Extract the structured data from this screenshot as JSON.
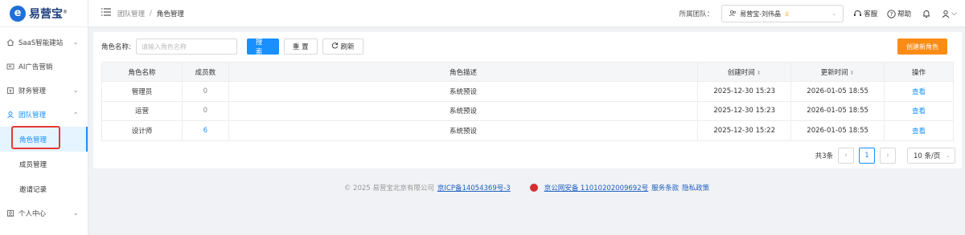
{
  "logo": {
    "text": "易营宝",
    "registered": "®"
  },
  "sidebar": {
    "items": [
      {
        "label": "SaaS智能建站",
        "chevron": "⌄"
      },
      {
        "label": "AI广告营销",
        "chevron": ""
      },
      {
        "label": "财务管理",
        "chevron": "⌄"
      },
      {
        "label": "团队管理",
        "chevron": "⌃"
      }
    ],
    "sub_items": [
      {
        "label": "角色管理"
      },
      {
        "label": "成员管理"
      },
      {
        "label": "邀请记录"
      }
    ],
    "personal": {
      "label": "个人中心",
      "chevron": "⌄"
    }
  },
  "header": {
    "breadcrumb": {
      "parent": "团队管理",
      "sep": "/",
      "current": "角色管理"
    },
    "team_label": "所属团队：",
    "team_value": "易营宝-刘伟晶",
    "service": "客服",
    "help": "帮助"
  },
  "filter": {
    "label": "角色名称:",
    "placeholder": "请输入角色名称",
    "search": "搜 索",
    "reset": "重 置",
    "refresh": "刷新",
    "create": "创建新角色"
  },
  "table": {
    "headers": {
      "name": "角色名称",
      "count": "成员数",
      "desc": "角色描述",
      "created": "创建时间",
      "updated": "更新时间",
      "action": "操作"
    },
    "rows": [
      {
        "name": "管理员",
        "count": "0",
        "desc": "系统预设",
        "created": "2025-12-30 15:23",
        "updated": "2026-01-05 18:55",
        "action": "查看"
      },
      {
        "name": "运营",
        "count": "0",
        "desc": "系统预设",
        "created": "2025-12-30 15:23",
        "updated": "2026-01-05 18:55",
        "action": "查看"
      },
      {
        "name": "设计师",
        "count": "6",
        "desc": "系统预设",
        "created": "2025-12-30 15:22",
        "updated": "2026-01-05 18:55",
        "action": "查看"
      }
    ]
  },
  "pager": {
    "total": "共3条",
    "page": "1",
    "size": "10 条/页"
  },
  "footer": {
    "copyright": "© 2025 易营宝北京有限公司",
    "icp": "京ICP备14054369号-3",
    "police": "京公网安备 11010202009692号",
    "terms": "服务条款",
    "privacy": "隐私政策"
  },
  "colors": {
    "primary": "#1890ff",
    "orange": "#fa8c16",
    "logo": "#1e6fd9"
  }
}
